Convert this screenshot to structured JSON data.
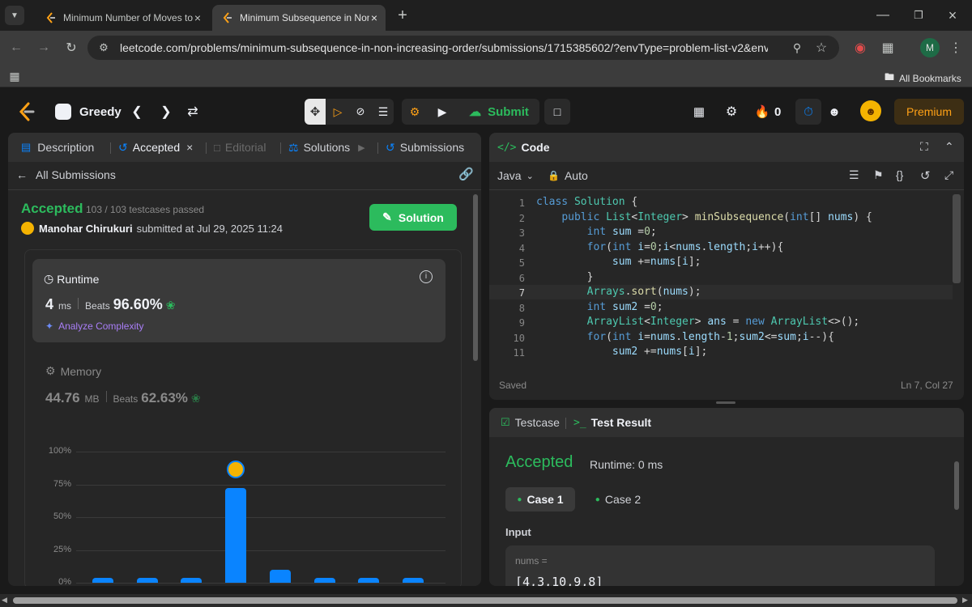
{
  "browser": {
    "tabs": [
      {
        "title": "Minimum Number of Moves to"
      },
      {
        "title": "Minimum Subsequence in Non"
      }
    ],
    "url": "leetcode.com/problems/minimum-subsequence-in-non-increasing-order/submissions/1715385602/?envType=problem-list-v2&envId=gre...",
    "profile_initial": "M",
    "bookmarks_label": "All Bookmarks"
  },
  "nav": {
    "problem_list": "Greedy",
    "submit_label": "Submit",
    "streak_count": "0",
    "premium_label": "Premium"
  },
  "left": {
    "tabs": {
      "description": "Description",
      "accepted": "Accepted",
      "editorial": "Editorial",
      "solutions": "Solutions",
      "submissions": "Submissions"
    },
    "back_label": "All Submissions",
    "status": "Accepted",
    "testcases": "103 / 103 testcases passed",
    "user": "Manohar Chirukuri",
    "submitted": "submitted at Jul 29, 2025 11:24",
    "solution_button": "Solution",
    "runtime": {
      "title": "Runtime",
      "value": "4",
      "unit": "ms",
      "beats_label": "Beats",
      "beats_value": "96.60%",
      "analyze": "Analyze Complexity"
    },
    "memory": {
      "title": "Memory",
      "value": "44.76",
      "unit": "MB",
      "beats_label": "Beats",
      "beats_value": "62.63%"
    }
  },
  "chart_data": {
    "type": "bar",
    "yticks": [
      "100%",
      "75%",
      "50%",
      "25%",
      "0%"
    ],
    "ylim": [
      0,
      100
    ],
    "values": [
      4,
      4,
      4,
      72,
      10,
      4,
      4,
      4
    ],
    "highlight_index": 3
  },
  "editor": {
    "title": "Code",
    "language": "Java",
    "mode": "Auto",
    "status": "Saved",
    "cursor": "Ln 7, Col 27",
    "lines": [
      "class Solution {",
      "    public List<Integer> minSubsequence(int[] nums) {",
      "        int sum =0;",
      "        for(int i=0;i<nums.length;i++){",
      "            sum +=nums[i];",
      "        }",
      "        Arrays.sort(nums);",
      "        int sum2 =0;",
      "        ArrayList<Integer> ans = new ArrayList<>();",
      "        for(int i=nums.length-1;sum2<=sum;i--){",
      "            sum2 +=nums[i];"
    ]
  },
  "result": {
    "tab_testcase": "Testcase",
    "tab_result": "Test Result",
    "status": "Accepted",
    "runtime": "Runtime: 0 ms",
    "case1": "Case 1",
    "case2": "Case 2",
    "input_label": "Input",
    "var_label": "nums =",
    "var_value": "[4,3,10,9,8]"
  }
}
